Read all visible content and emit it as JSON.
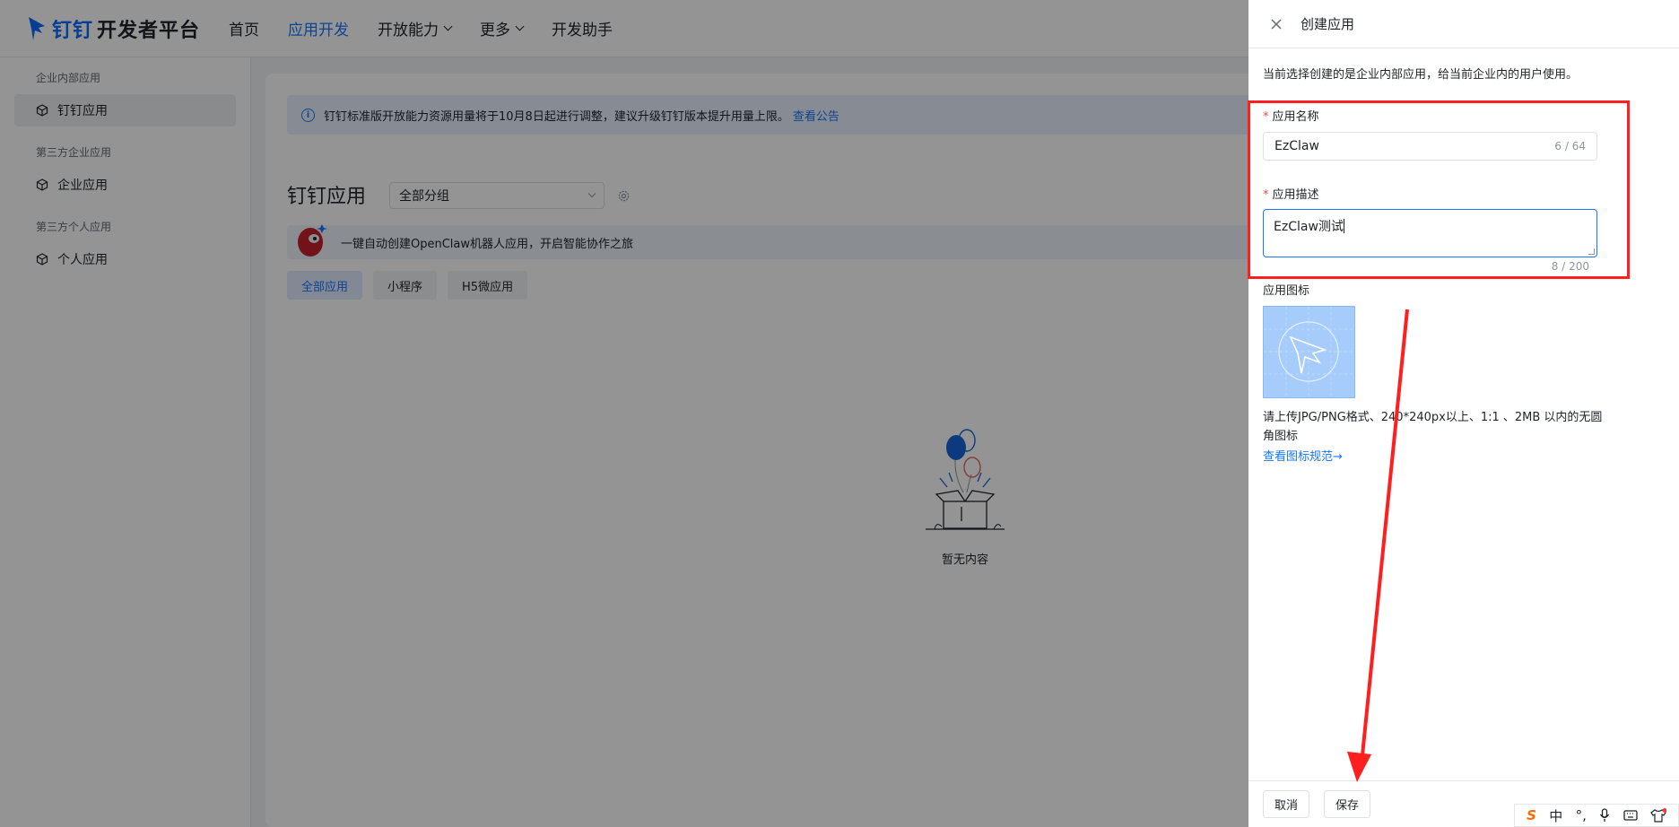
{
  "nav": {
    "brand": "钉钉",
    "title": "开发者平台",
    "items": [
      {
        "label": "首页",
        "active": false,
        "dropdown": false
      },
      {
        "label": "应用开发",
        "active": true,
        "dropdown": false
      },
      {
        "label": "开放能力",
        "active": false,
        "dropdown": true
      },
      {
        "label": "更多",
        "active": false,
        "dropdown": true
      },
      {
        "label": "开发助手",
        "active": false,
        "dropdown": false
      }
    ]
  },
  "sidebar": {
    "groups": [
      {
        "title": "企业内部应用",
        "item": "钉钉应用",
        "active": true
      },
      {
        "title": "第三方企业应用",
        "item": "企业应用",
        "active": false
      },
      {
        "title": "第三方个人应用",
        "item": "个人应用",
        "active": false
      }
    ]
  },
  "main": {
    "notice_text": "钉钉标准版开放能力资源用量将于10月8日起进行调整，建议升级钉钉版本提升用量上限。",
    "notice_link": "查看公告",
    "title": "钉钉应用",
    "group_select": "全部分组",
    "banner_text": "一键自动创建OpenClaw机器人应用，开启智能协作之旅",
    "tabs": [
      {
        "label": "全部应用",
        "active": true
      },
      {
        "label": "小程序",
        "active": false
      },
      {
        "label": "H5微应用",
        "active": false
      }
    ],
    "empty_text": "暂无内容"
  },
  "drawer": {
    "title": "创建应用",
    "hint": "当前选择创建的是企业内部应用，给当前企业内的用户使用。",
    "name_label": "应用名称",
    "name_value": "EzClaw",
    "name_count": "6 / 64",
    "desc_label": "应用描述",
    "desc_value": "EzClaw测试",
    "desc_count": "8 / 200",
    "icon_label": "应用图标",
    "icon_hint": "请上传JPG/PNG格式、240*240px以上、1:1 、2MB 以内的无圆角图标",
    "icon_link": "查看图标规范→",
    "cancel": "取消",
    "save": "保存"
  },
  "ime": {
    "lang": "中",
    "punct": "°,"
  },
  "colors": {
    "primary": "#1677ff",
    "annotation": "#ff1f1f",
    "required": "#f54a45"
  }
}
